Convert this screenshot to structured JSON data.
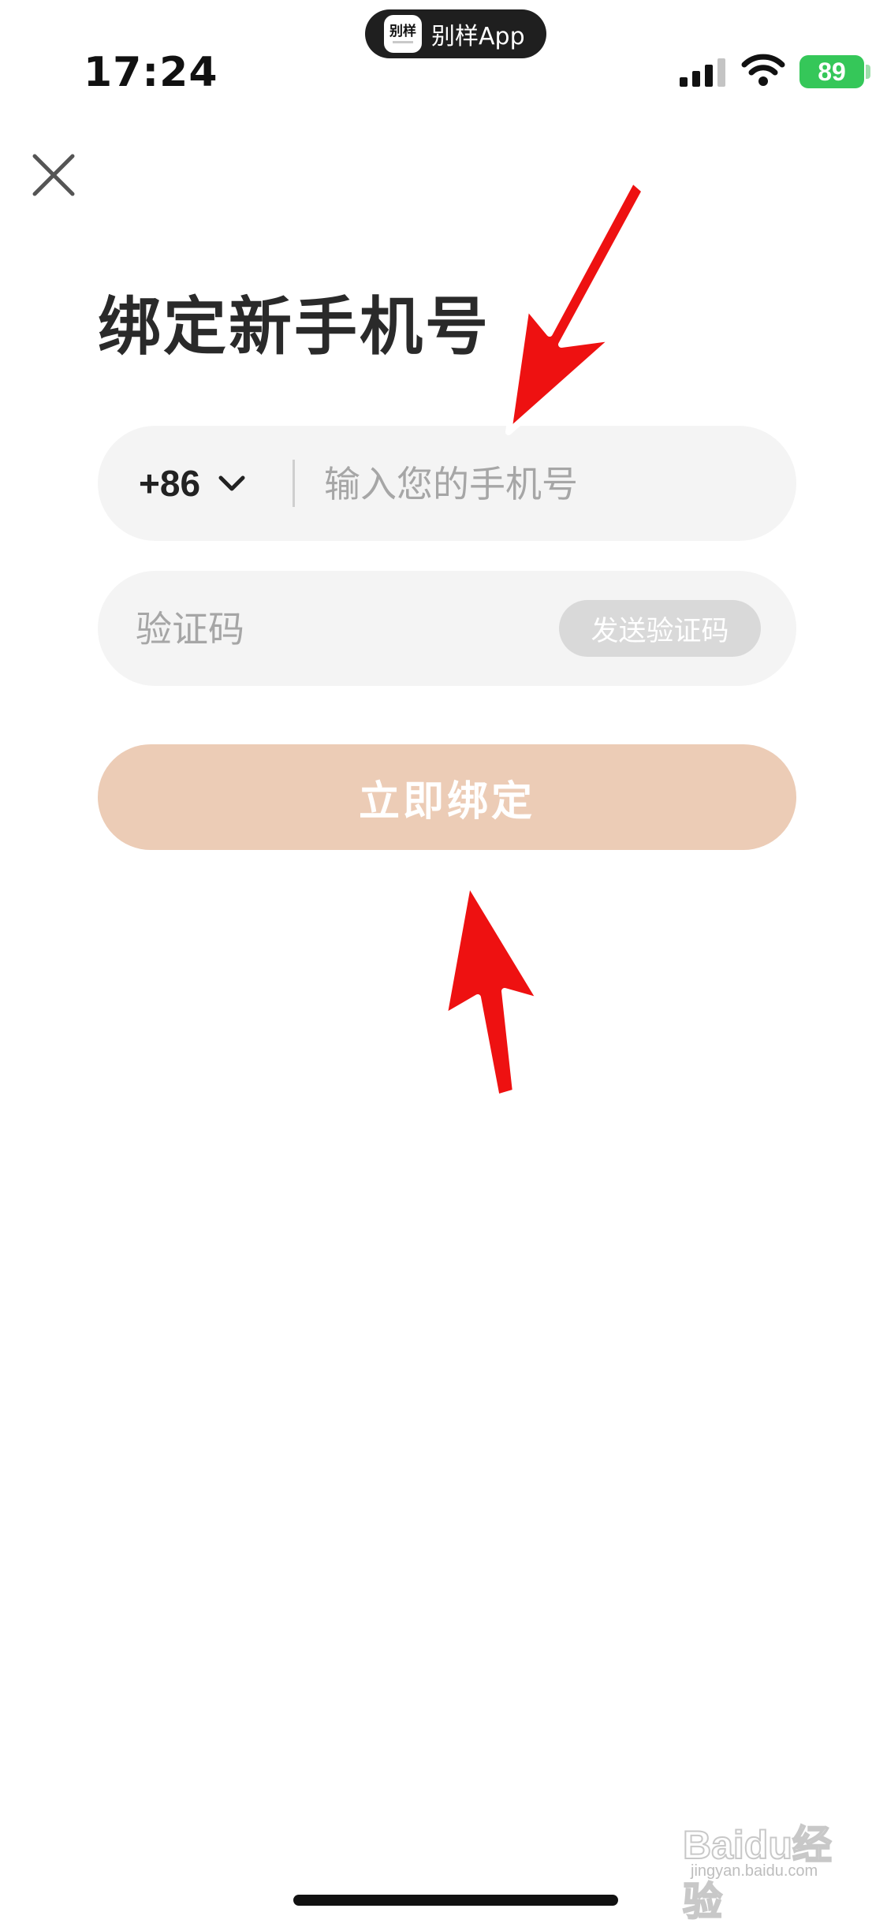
{
  "status_bar": {
    "time": "17:24",
    "app_indicator": "别样App",
    "app_logo_text": "别样",
    "battery": "89",
    "battery_color": "#35c759",
    "icons": [
      "signal-icon",
      "wifi-icon",
      "battery-icon"
    ]
  },
  "header": {
    "close_icon": "close-icon"
  },
  "title": "绑定新手机号",
  "phone": {
    "country_code": "+86",
    "placeholder": "输入您的手机号",
    "value": ""
  },
  "verification": {
    "placeholder": "验证码",
    "value": "",
    "send_label": "发送验证码"
  },
  "submit": {
    "label": "立即绑定",
    "color": "#ecccb6"
  },
  "annotations": {
    "arrow_color": "#ee1111"
  },
  "watermark": {
    "main": "Baidu经验",
    "sub": "jingyan.baidu.com"
  }
}
